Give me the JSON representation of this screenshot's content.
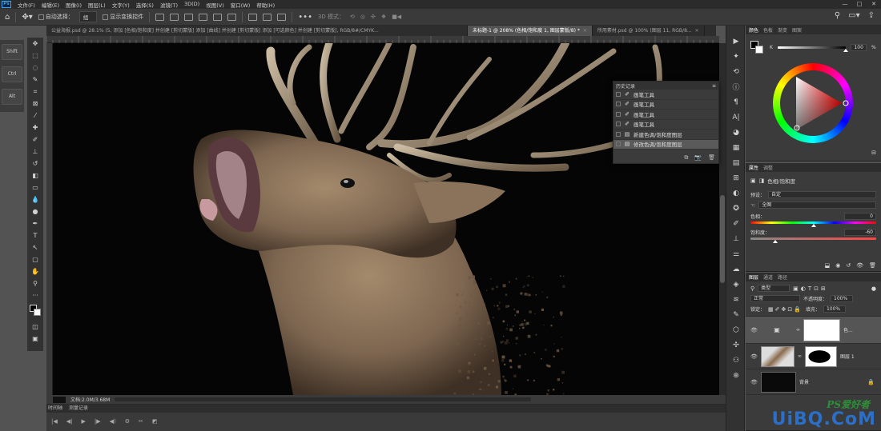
{
  "app": {
    "logo": "Ps"
  },
  "menu": [
    "文件(F)",
    "编辑(E)",
    "图像(I)",
    "图层(L)",
    "文字(Y)",
    "选择(S)",
    "滤镜(T)",
    "3D(D)",
    "视图(V)",
    "窗口(W)",
    "帮助(H)"
  ],
  "window_controls": [
    "—",
    "□",
    "✕"
  ],
  "options": {
    "auto_select": "自动选择：",
    "auto_select_value": "组",
    "show_transform": "显示变换控件",
    "mode_3d": "3D 模式："
  },
  "doc_tabs": [
    {
      "label": "公益海报.psd @ 28.1% (5, 添加 [色相/饱和度] 并创建 [剪切蒙版] 添加 [曲线] 并创建 [剪切蒙版] 添加 [可选颜色] 并创建 [剪切蒙版], RGB/8#/CMYK...",
      "active": false
    },
    {
      "label": "未标题-1 @ 208% (色相/饱和度 1, 图层蒙版/8) *",
      "active": true
    },
    {
      "label": "所用素材.psd @ 100% (图层 11, RGB/8...",
      "active": false
    }
  ],
  "keyboard_panel": [
    "Shift",
    "Ctrl",
    "Alt"
  ],
  "tools": [
    {
      "name": "move-tool-icon",
      "glyph": "✥"
    },
    {
      "name": "marquee-tool-icon",
      "glyph": "⬚"
    },
    {
      "name": "lasso-tool-icon",
      "glyph": "◌"
    },
    {
      "name": "quick-select-tool-icon",
      "glyph": "✎"
    },
    {
      "name": "crop-tool-icon",
      "glyph": "⌗"
    },
    {
      "name": "frame-tool-icon",
      "glyph": "⊠"
    },
    {
      "name": "eyedropper-tool-icon",
      "glyph": "⁄"
    },
    {
      "name": "healing-brush-icon",
      "glyph": "✚"
    },
    {
      "name": "brush-tool-icon",
      "glyph": "✐"
    },
    {
      "name": "clone-stamp-icon",
      "glyph": "⊥"
    },
    {
      "name": "history-brush-icon",
      "glyph": "↺"
    },
    {
      "name": "eraser-tool-icon",
      "glyph": "◧"
    },
    {
      "name": "gradient-tool-icon",
      "glyph": "▭"
    },
    {
      "name": "blur-tool-icon",
      "glyph": "💧"
    },
    {
      "name": "dodge-tool-icon",
      "glyph": "●"
    },
    {
      "name": "pen-tool-icon",
      "glyph": "✒"
    },
    {
      "name": "type-tool-icon",
      "glyph": "T"
    },
    {
      "name": "path-select-icon",
      "glyph": "↖"
    },
    {
      "name": "rectangle-tool-icon",
      "glyph": "▢"
    },
    {
      "name": "hand-tool-icon",
      "glyph": "✋"
    },
    {
      "name": "zoom-tool-icon",
      "glyph": "⚲"
    },
    {
      "name": "more-tools-icon",
      "glyph": "···"
    }
  ],
  "history_panel": {
    "title": "历史记录",
    "items": [
      {
        "label": "画笔工具",
        "icon": "brush",
        "selected": false
      },
      {
        "label": "画笔工具",
        "icon": "brush",
        "selected": false
      },
      {
        "label": "画笔工具",
        "icon": "brush",
        "selected": false
      },
      {
        "label": "画笔工具",
        "icon": "brush",
        "selected": false
      },
      {
        "label": "新建色调/饱和度图层",
        "icon": "doc",
        "selected": false
      },
      {
        "label": "修改色调/饱和度图层",
        "icon": "doc",
        "selected": true
      }
    ]
  },
  "status": {
    "doc_size": "文档:2.0M/3.68M"
  },
  "timeline": {
    "tabs": [
      "时间轴",
      "测量记录"
    ]
  },
  "color_panel": {
    "tabs": [
      "颜色",
      "色板",
      "渐变",
      "图案"
    ],
    "k_label": "K",
    "k_value": "100",
    "k_unit": "%",
    "k_level": 1.0
  },
  "properties_panel": {
    "tabs": [
      "属性",
      "调整"
    ],
    "layer_type": "色相/饱和度",
    "preset_label": "预设：",
    "preset_value": "自定",
    "channel_value": "全图",
    "hue_label": "色相：",
    "hue_value": "0",
    "saturation_label": "饱和度：",
    "saturation_value": "-60",
    "lightness_label": "明度：",
    "lightness_value": "0"
  },
  "layers_panel": {
    "tabs": [
      "图层",
      "通道",
      "路径"
    ],
    "filter_kind": "类型",
    "blend_mode": "正常",
    "opacity_label": "不透明度：",
    "opacity_value": "100%",
    "lock_label": "锁定：",
    "fill_label": "填充：",
    "fill_value": "100%",
    "layers": [
      {
        "name": "色...",
        "type": "adjustment",
        "selected": true
      },
      {
        "name": "图层 1",
        "type": "image",
        "selected": false
      },
      {
        "name": "背景",
        "type": "background",
        "selected": false
      }
    ]
  },
  "watermark": {
    "text": "UiBQ.CoM",
    "sub": "PS爱好者"
  },
  "colors": {
    "menubar": "#2b2b2b",
    "panel": "#3b3b3b",
    "canvas": "#050505",
    "accent": "#31a8ff"
  }
}
